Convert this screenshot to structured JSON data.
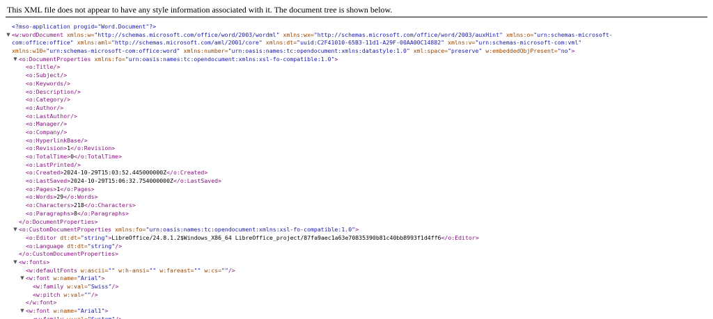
{
  "info_bar": {
    "message": "This XML file does not appear to have any style information associated with it. The document tree is shown below."
  },
  "colors": {
    "tag": "#881280",
    "attr_name": "#994500",
    "attr_value": "#1a1aa6",
    "text": "#000000",
    "toggle": "#555555"
  },
  "icons": {
    "expanded": "collapse-triangle-icon"
  },
  "tree": [
    {
      "level": 0,
      "segments": [
        {
          "c": "pi",
          "t": "<?mso-application progid=\"Word.Document\"?>"
        }
      ]
    },
    {
      "level": 0,
      "toggle": "▼",
      "segments": [
        {
          "c": "tag",
          "t": "<w:wordDocument"
        },
        {
          "c": "attr-name",
          "t": " xmlns:w="
        },
        {
          "c": "attr-value",
          "t": "\"http://schemas.microsoft.com/office/word/2003/wordml\""
        },
        {
          "c": "attr-name",
          "t": " xmlns:wx="
        },
        {
          "c": "attr-value",
          "t": "\"http://schemas.microsoft.com/office/word/2003/auxHint\""
        },
        {
          "c": "attr-name",
          "t": " xmlns:o="
        },
        {
          "c": "attr-value",
          "t": "\"urn:schemas-microsoft-"
        }
      ]
    },
    {
      "level": 0,
      "segments": [
        {
          "c": "attr-value",
          "t": "com:office:office\""
        },
        {
          "c": "attr-name",
          "t": " xmlns:aml="
        },
        {
          "c": "attr-value",
          "t": "\"http://schemas.microsoft.com/aml/2001/core\""
        },
        {
          "c": "attr-name",
          "t": " xmlns:dt="
        },
        {
          "c": "attr-value",
          "t": "\"uuid:C2F41010-65B3-11d1-A29F-00AA00C14882\""
        },
        {
          "c": "attr-name",
          "t": " xmlns:v="
        },
        {
          "c": "attr-value",
          "t": "\"urn:schemas-microsoft-com:vml\""
        }
      ]
    },
    {
      "level": 0,
      "segments": [
        {
          "c": "attr-name",
          "t": "xmlns:w10="
        },
        {
          "c": "attr-value",
          "t": "\"urn:schemas-microsoft-com:office:word\""
        },
        {
          "c": "attr-name",
          "t": " xmlns:number="
        },
        {
          "c": "attr-value",
          "t": "\"urn:oasis:names:tc:opendocument:xmlns:datastyle:1.0\""
        },
        {
          "c": "attr-name",
          "t": " xml:space="
        },
        {
          "c": "attr-value",
          "t": "\"preserve\""
        },
        {
          "c": "attr-name",
          "t": " w:embeddedObjPresent="
        },
        {
          "c": "attr-value",
          "t": "\"no\""
        },
        {
          "c": "tag",
          "t": ">"
        }
      ]
    },
    {
      "level": 1,
      "toggle": "▼",
      "segments": [
        {
          "c": "tag",
          "t": "<o:DocumentProperties"
        },
        {
          "c": "attr-name",
          "t": " xmlns:fo="
        },
        {
          "c": "attr-value",
          "t": "\"urn:oasis:names:tc:opendocument:xmlns:xsl-fo-compatible:1.0\""
        },
        {
          "c": "tag",
          "t": ">"
        }
      ]
    },
    {
      "level": 2,
      "segments": [
        {
          "c": "tag",
          "t": "<o:Title/>"
        }
      ]
    },
    {
      "level": 2,
      "segments": [
        {
          "c": "tag",
          "t": "<o:Subject/>"
        }
      ]
    },
    {
      "level": 2,
      "segments": [
        {
          "c": "tag",
          "t": "<o:Keywords/>"
        }
      ]
    },
    {
      "level": 2,
      "segments": [
        {
          "c": "tag",
          "t": "<o:Description/>"
        }
      ]
    },
    {
      "level": 2,
      "segments": [
        {
          "c": "tag",
          "t": "<o:Category/>"
        }
      ]
    },
    {
      "level": 2,
      "segments": [
        {
          "c": "tag",
          "t": "<o:Author/>"
        }
      ]
    },
    {
      "level": 2,
      "segments": [
        {
          "c": "tag",
          "t": "<o:LastAuthor/>"
        }
      ]
    },
    {
      "level": 2,
      "segments": [
        {
          "c": "tag",
          "t": "<o:Manager/>"
        }
      ]
    },
    {
      "level": 2,
      "segments": [
        {
          "c": "tag",
          "t": "<o:Company/>"
        }
      ]
    },
    {
      "level": 2,
      "segments": [
        {
          "c": "tag",
          "t": "<o:HyperlinkBase/>"
        }
      ]
    },
    {
      "level": 2,
      "segments": [
        {
          "c": "tag",
          "t": "<o:Revision>"
        },
        {
          "c": "text",
          "t": "1"
        },
        {
          "c": "tag",
          "t": "</o:Revision>"
        }
      ]
    },
    {
      "level": 2,
      "segments": [
        {
          "c": "tag",
          "t": "<o:TotalTime>"
        },
        {
          "c": "text",
          "t": "0"
        },
        {
          "c": "tag",
          "t": "</o:TotalTime>"
        }
      ]
    },
    {
      "level": 2,
      "segments": [
        {
          "c": "tag",
          "t": "<o:LastPrinted/>"
        }
      ]
    },
    {
      "level": 2,
      "segments": [
        {
          "c": "tag",
          "t": "<o:Created>"
        },
        {
          "c": "text",
          "t": "2024-10-29T15:03:52.445000000Z"
        },
        {
          "c": "tag",
          "t": "</o:Created>"
        }
      ]
    },
    {
      "level": 2,
      "segments": [
        {
          "c": "tag",
          "t": "<o:LastSaved>"
        },
        {
          "c": "text",
          "t": "2024-10-29T15:06:32.754000000Z"
        },
        {
          "c": "tag",
          "t": "</o:LastSaved>"
        }
      ]
    },
    {
      "level": 2,
      "segments": [
        {
          "c": "tag",
          "t": "<o:Pages>"
        },
        {
          "c": "text",
          "t": "1"
        },
        {
          "c": "tag",
          "t": "</o:Pages>"
        }
      ]
    },
    {
      "level": 2,
      "segments": [
        {
          "c": "tag",
          "t": "<o:Words>"
        },
        {
          "c": "text",
          "t": "29"
        },
        {
          "c": "tag",
          "t": "</o:Words>"
        }
      ]
    },
    {
      "level": 2,
      "segments": [
        {
          "c": "tag",
          "t": "<o:Characters>"
        },
        {
          "c": "text",
          "t": "218"
        },
        {
          "c": "tag",
          "t": "</o:Characters>"
        }
      ]
    },
    {
      "level": 2,
      "segments": [
        {
          "c": "tag",
          "t": "<o:Paragraphs>"
        },
        {
          "c": "text",
          "t": "8"
        },
        {
          "c": "tag",
          "t": "</o:Paragraphs>"
        }
      ]
    },
    {
      "level": 1,
      "segments": [
        {
          "c": "tag",
          "t": "</o:DocumentProperties>"
        }
      ]
    },
    {
      "level": 1,
      "toggle": "▼",
      "segments": [
        {
          "c": "tag",
          "t": "<o:CustomDocumentProperties"
        },
        {
          "c": "attr-name",
          "t": " xmlns:fo="
        },
        {
          "c": "attr-value",
          "t": "\"urn:oasis:names:tc:opendocument:xmlns:xsl-fo-compatible:1.0\""
        },
        {
          "c": "tag",
          "t": ">"
        }
      ]
    },
    {
      "level": 2,
      "segments": [
        {
          "c": "tag",
          "t": "<o:Editor"
        },
        {
          "c": "attr-name",
          "t": " dt:dt="
        },
        {
          "c": "attr-value",
          "t": "\"string\""
        },
        {
          "c": "tag",
          "t": ">"
        },
        {
          "c": "text",
          "t": "LibreOffice/24.8.1.2$Windows_X86_64 LibreOffice_project/87fa9aec1a63e70835390b81c40bb8993f1d4ff6"
        },
        {
          "c": "tag",
          "t": "</o:Editor>"
        }
      ]
    },
    {
      "level": 2,
      "segments": [
        {
          "c": "tag",
          "t": "<o:Language"
        },
        {
          "c": "attr-name",
          "t": " dt:dt="
        },
        {
          "c": "attr-value",
          "t": "\"string\""
        },
        {
          "c": "tag",
          "t": "/>"
        }
      ]
    },
    {
      "level": 1,
      "segments": [
        {
          "c": "tag",
          "t": "</o:CustomDocumentProperties>"
        }
      ]
    },
    {
      "level": 1,
      "toggle": "▼",
      "segments": [
        {
          "c": "tag",
          "t": "<w:fonts>"
        }
      ]
    },
    {
      "level": 2,
      "segments": [
        {
          "c": "tag",
          "t": "<w:defaultFonts"
        },
        {
          "c": "attr-name",
          "t": " w:ascii="
        },
        {
          "c": "attr-value",
          "t": "\"\""
        },
        {
          "c": "attr-name",
          "t": " w:h-ansi="
        },
        {
          "c": "attr-value",
          "t": "\"\""
        },
        {
          "c": "attr-name",
          "t": " w:fareast="
        },
        {
          "c": "attr-value",
          "t": "\"\""
        },
        {
          "c": "attr-name",
          "t": " w:cs="
        },
        {
          "c": "attr-value",
          "t": "\"\""
        },
        {
          "c": "tag",
          "t": "/>"
        }
      ]
    },
    {
      "level": 2,
      "toggle": "▼",
      "segments": [
        {
          "c": "tag",
          "t": "<w:font"
        },
        {
          "c": "attr-name",
          "t": " w:name="
        },
        {
          "c": "attr-value",
          "t": "\"Arial\""
        },
        {
          "c": "tag",
          "t": ">"
        }
      ]
    },
    {
      "level": 3,
      "segments": [
        {
          "c": "tag",
          "t": "<w:family"
        },
        {
          "c": "attr-name",
          "t": " w:val="
        },
        {
          "c": "attr-value",
          "t": "\"Swiss\""
        },
        {
          "c": "tag",
          "t": "/>"
        }
      ]
    },
    {
      "level": 3,
      "segments": [
        {
          "c": "tag",
          "t": "<w:pitch"
        },
        {
          "c": "attr-name",
          "t": " w:val="
        },
        {
          "c": "attr-value",
          "t": "\"\""
        },
        {
          "c": "tag",
          "t": "/>"
        }
      ]
    },
    {
      "level": 2,
      "segments": [
        {
          "c": "tag",
          "t": "</w:font>"
        }
      ]
    },
    {
      "level": 2,
      "toggle": "▼",
      "segments": [
        {
          "c": "tag",
          "t": "<w:font"
        },
        {
          "c": "attr-name",
          "t": " w:name="
        },
        {
          "c": "attr-value",
          "t": "\"Arial1\""
        },
        {
          "c": "tag",
          "t": ">"
        }
      ]
    },
    {
      "level": 3,
      "segments": [
        {
          "c": "tag",
          "t": "<w:family"
        },
        {
          "c": "attr-name",
          "t": " w:val="
        },
        {
          "c": "attr-value",
          "t": "\"System\""
        },
        {
          "c": "tag",
          "t": "/>"
        }
      ]
    }
  ]
}
